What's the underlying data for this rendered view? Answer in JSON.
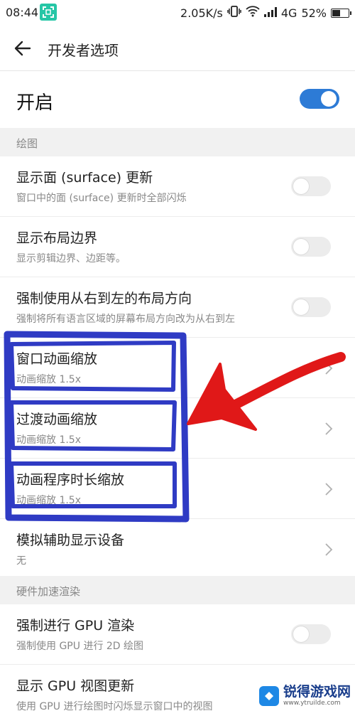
{
  "status_bar": {
    "time": "08:44",
    "speed": "2.05K/s",
    "network": "4G",
    "battery": "52%",
    "battery_level": 0.52
  },
  "header": {
    "title": "开发者选项"
  },
  "master": {
    "label": "开启",
    "enabled": true
  },
  "sections": {
    "drawing": "绘图",
    "hw_accel": "硬件加速渲染"
  },
  "rows": {
    "surface": {
      "title": "显示面 (surface) 更新",
      "subtitle": "窗口中的面 (surface) 更新时全部闪烁"
    },
    "layout_bounds": {
      "title": "显示布局边界",
      "subtitle": "显示剪辑边界、边距等。"
    },
    "rtl": {
      "title": "强制使用从右到左的布局方向",
      "subtitle": "强制将所有语言区域的屏幕布局方向改为从右到左"
    },
    "window_anim": {
      "title": "窗口动画缩放",
      "subtitle": "动画缩放 1.5x"
    },
    "transition_anim": {
      "title": "过渡动画缩放",
      "subtitle": "动画缩放 1.5x"
    },
    "animator_duration": {
      "title": "动画程序时长缩放",
      "subtitle": "动画缩放 1.5x"
    },
    "secondary_display": {
      "title": "模拟辅助显示设备",
      "subtitle": "无"
    },
    "force_gpu": {
      "title": "强制进行 GPU 渲染",
      "subtitle": "强制使用 GPU 进行 2D 绘图"
    },
    "gpu_view_updates": {
      "title": "显示 GPU 视图更新",
      "subtitle": "使用 GPU 进行绘图时闪烁显示窗口中的视图"
    }
  },
  "watermark": {
    "title": "锐得游戏网",
    "url": "www.ytruilde.com"
  },
  "colors": {
    "accent": "#2d7bd6",
    "annotation_blue": "#2f3bc4",
    "annotation_red": "#e01818"
  }
}
